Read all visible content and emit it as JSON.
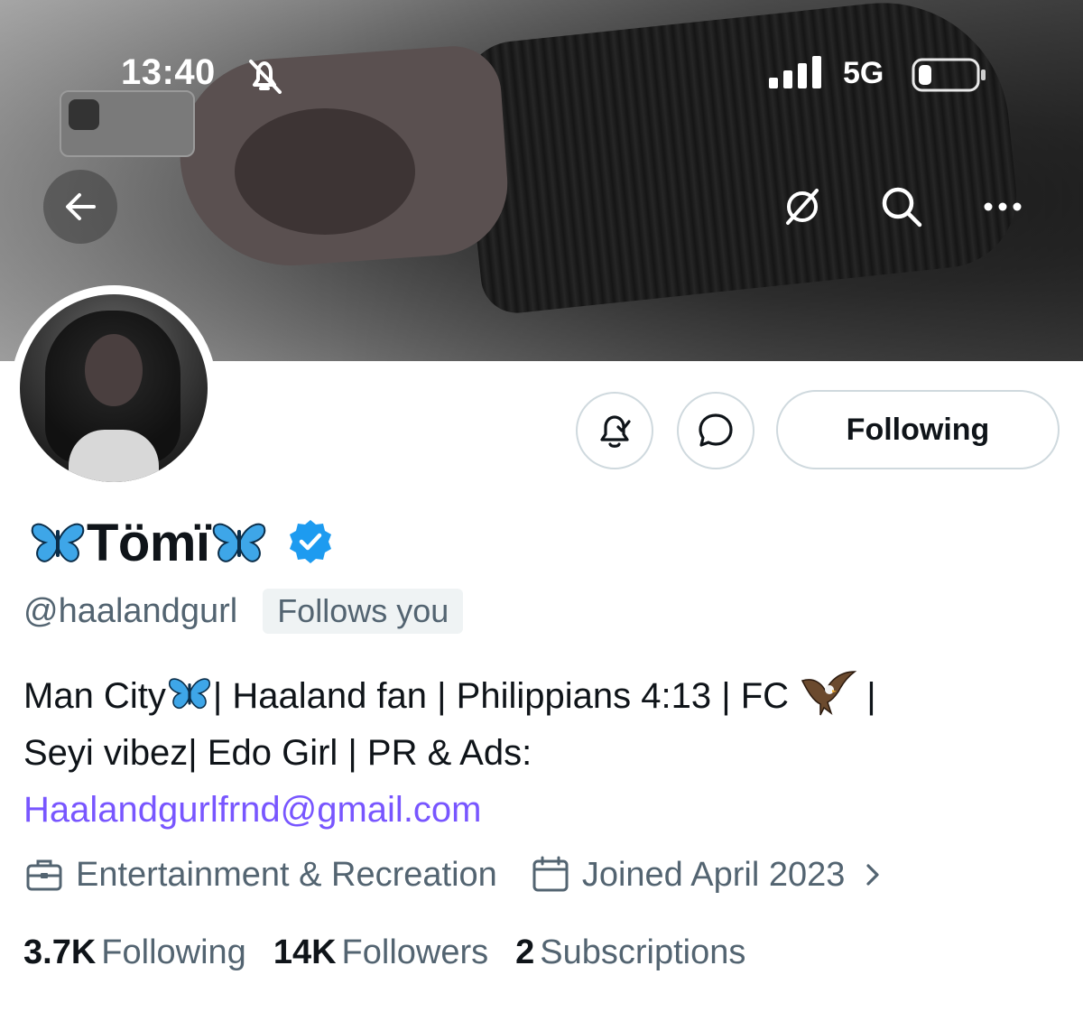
{
  "status_bar": {
    "time": "13:40",
    "network": "5G"
  },
  "header_icons": [
    "back-arrow-icon",
    "grok-icon",
    "search-icon",
    "more-icon"
  ],
  "profile": {
    "display_name": "Tömï",
    "handle": "@haalandgurl",
    "follows_you_badge": "Follows you",
    "following_button_label": "Following",
    "bio": {
      "line1_part1": "Man City",
      "line1_part2": "| Haaland fan | Philippians 4:13 | FC ",
      "line1_part3": " |",
      "line2": "Seyi vibez| Edo Girl | PR & Ads:",
      "email_link": "Haalandgurlfrnd@gmail.com"
    },
    "category": "Entertainment & Recreation",
    "joined": "Joined April 2023",
    "stats": {
      "following_count": "3.7K",
      "following_label": "Following",
      "followers_count": "14K",
      "followers_label": "Followers",
      "subscriptions_count": "2",
      "subscriptions_label": "Subscriptions"
    }
  },
  "colors": {
    "text_primary": "#0f1419",
    "text_secondary": "#536471",
    "link": "#7856ff",
    "verified_blue": "#1d9bf0",
    "button_border": "#cfd9de",
    "badge_bg": "#eff3f4"
  }
}
